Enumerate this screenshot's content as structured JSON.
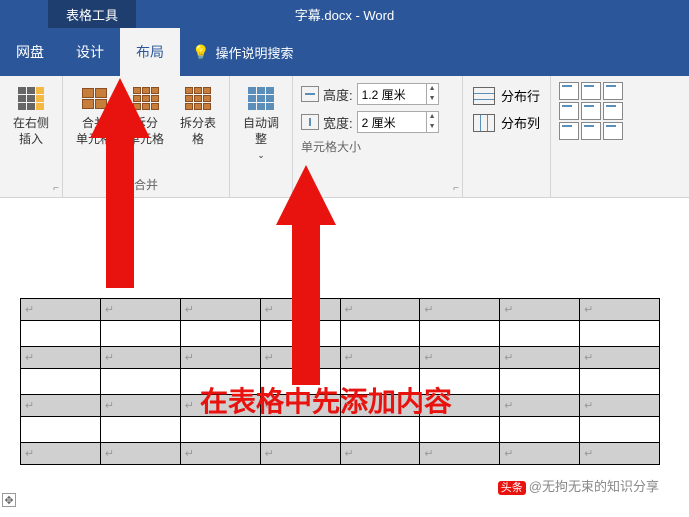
{
  "titlebar": {
    "tool_tab": "表格工具",
    "title": "字幕.docx - Word"
  },
  "tabs": {
    "pan": "网盘",
    "design": "设计",
    "layout": "布局",
    "search": "操作说明搜索"
  },
  "ribbon": {
    "insert_right": "在右侧插入",
    "merge_cells": "合并\n单元格",
    "split_cells": "拆分\n单元格",
    "split_table": "拆分表格",
    "merge_group": "合并",
    "autofit": "自动调整",
    "height_label": "高度:",
    "height_value": "1.2 厘米",
    "width_label": "宽度:",
    "width_value": "2 厘米",
    "cellsize_group": "单元格大小",
    "dist_rows": "分布行",
    "dist_cols": "分布列"
  },
  "annotation": "在表格中先添加内容",
  "watermark": "@无拘无束的知识分享"
}
